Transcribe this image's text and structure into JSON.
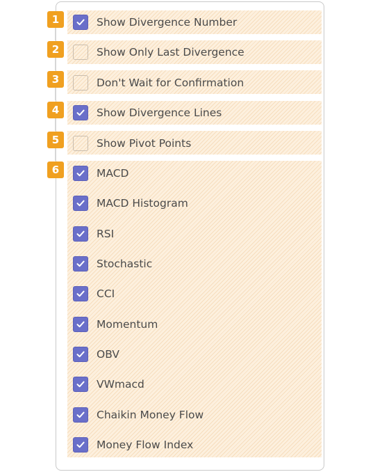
{
  "badges": [
    "1",
    "2",
    "3",
    "4",
    "5",
    "6"
  ],
  "settings": [
    {
      "label": "Show Divergence Number",
      "checked": true
    },
    {
      "label": "Show Only Last Divergence",
      "checked": false
    },
    {
      "label": "Don't Wait for Confirmation",
      "checked": false
    },
    {
      "label": "Show Divergence Lines",
      "checked": true
    },
    {
      "label": "Show Pivot Points",
      "checked": false
    }
  ],
  "indicators": [
    {
      "label": "MACD",
      "checked": true
    },
    {
      "label": "MACD Histogram",
      "checked": true
    },
    {
      "label": "RSI",
      "checked": true
    },
    {
      "label": "Stochastic",
      "checked": true
    },
    {
      "label": "CCI",
      "checked": true
    },
    {
      "label": "Momentum",
      "checked": true
    },
    {
      "label": "OBV",
      "checked": true
    },
    {
      "label": "VWmacd",
      "checked": true
    },
    {
      "label": "Chaikin Money Flow",
      "checked": true
    },
    {
      "label": "Money Flow Index",
      "checked": true
    }
  ],
  "colors": {
    "accent": "#6a6fc9",
    "badge": "#f0a020",
    "stripe_bg": "#fdf0de"
  },
  "icons": {
    "checked": "checkmark-icon"
  }
}
